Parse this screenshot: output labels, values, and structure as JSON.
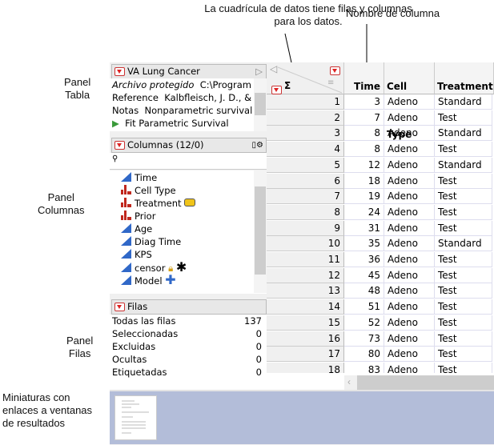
{
  "annotations": {
    "grid_note": "La cuadrícula de datos tiene filas y columnas para los datos.",
    "column_name": "Nombre de columna",
    "panel_table": [
      "Panel",
      "Tabla"
    ],
    "panel_columns": [
      "Panel",
      "Columnas"
    ],
    "panel_rows": [
      "Panel",
      "Filas"
    ],
    "thumbnails": [
      "Miniaturas con",
      "enlaces a ventanas",
      "de resultados"
    ]
  },
  "table_panel": {
    "title": "VA Lung Cancer",
    "lines": [
      {
        "label": "Archivo protegido",
        "value": "C:\\Program"
      },
      {
        "label": "Reference",
        "value": "Kalbfleisch, J. D., &"
      },
      {
        "label": "Notas",
        "value": "Nonparametric survival"
      }
    ],
    "script": "Fit Parametric Survival"
  },
  "columns_panel": {
    "title": "Columnas (12/0)",
    "search_placeholder": "",
    "items": [
      {
        "name": "Time",
        "type": "continuous",
        "badges": []
      },
      {
        "name": "Cell Type",
        "type": "nominal",
        "badges": []
      },
      {
        "name": "Treatment",
        "type": "nominal",
        "badges": [
          "label-tag"
        ]
      },
      {
        "name": "Prior",
        "type": "nominal",
        "badges": []
      },
      {
        "name": "Age",
        "type": "continuous",
        "badges": []
      },
      {
        "name": "Diag Time",
        "type": "continuous",
        "badges": []
      },
      {
        "name": "KPS",
        "type": "continuous",
        "badges": []
      },
      {
        "name": "censor",
        "type": "continuous",
        "badges": [
          "lock",
          "asterisk"
        ]
      },
      {
        "name": "Model",
        "type": "continuous",
        "badges": [
          "plus"
        ]
      }
    ]
  },
  "rows_panel": {
    "title": "Filas",
    "items": [
      {
        "label": "Todas las filas",
        "value": "137"
      },
      {
        "label": "Seleccionadas",
        "value": "0"
      },
      {
        "label": "Excluidas",
        "value": "0"
      },
      {
        "label": "Ocultas",
        "value": "0"
      },
      {
        "label": "Etiquetadas",
        "value": "0"
      }
    ]
  },
  "grid": {
    "sigma": "Σ",
    "headers": [
      "Time",
      "Cell Type",
      "Treatment"
    ],
    "rows": [
      [
        "1",
        "3",
        "Adeno",
        "Standard"
      ],
      [
        "2",
        "7",
        "Adeno",
        "Test"
      ],
      [
        "3",
        "8",
        "Adeno",
        "Standard"
      ],
      [
        "4",
        "8",
        "Adeno",
        "Test"
      ],
      [
        "5",
        "12",
        "Adeno",
        "Standard"
      ],
      [
        "6",
        "18",
        "Adeno",
        "Test"
      ],
      [
        "7",
        "19",
        "Adeno",
        "Test"
      ],
      [
        "8",
        "24",
        "Adeno",
        "Test"
      ],
      [
        "9",
        "31",
        "Adeno",
        "Test"
      ],
      [
        "10",
        "35",
        "Adeno",
        "Standard"
      ],
      [
        "11",
        "36",
        "Adeno",
        "Test"
      ],
      [
        "12",
        "45",
        "Adeno",
        "Test"
      ],
      [
        "13",
        "48",
        "Adeno",
        "Test"
      ],
      [
        "14",
        "51",
        "Adeno",
        "Test"
      ],
      [
        "15",
        "52",
        "Adeno",
        "Test"
      ],
      [
        "16",
        "73",
        "Adeno",
        "Test"
      ],
      [
        "17",
        "80",
        "Adeno",
        "Test"
      ],
      [
        "18",
        "83",
        "Adeno",
        "Test"
      ]
    ]
  },
  "colors": {
    "thumb_area": "#b3bdd9",
    "continuous": "#3068c8",
    "nominal": "#c0281e",
    "red_triangle": "#d22222"
  }
}
